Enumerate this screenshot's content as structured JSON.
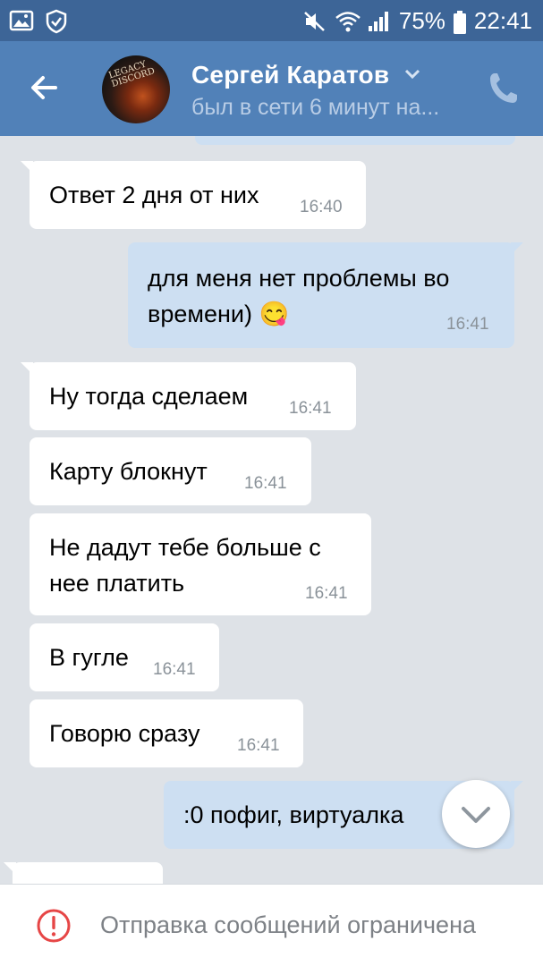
{
  "status_bar": {
    "battery": "75%",
    "time": "22:41",
    "icons": [
      "image-icon",
      "shield-icon",
      "mute-icon",
      "wifi-icon",
      "signal-icon",
      "battery-icon"
    ]
  },
  "header": {
    "contact_name": "Сергей Каратов",
    "contact_status": "был в сети 6 минут на...",
    "avatar_text": "LEGACY DISCORD",
    "colors": {
      "header_bg": "#5181b8",
      "status_bar_bg": "#3d6597"
    }
  },
  "messages": [
    {
      "direction": "in",
      "text": "Ответ 2 дня от них",
      "time": "16:40"
    },
    {
      "direction": "out",
      "text_line1": "для меня нет проблемы во",
      "text_line2": "времени) 😋",
      "time": "16:41"
    },
    {
      "direction": "in",
      "text": "Ну тогда сделаем",
      "time": "16:41"
    },
    {
      "direction": "in",
      "text": "Карту блокнут",
      "time": "16:41"
    },
    {
      "direction": "in",
      "text_line1": "Не дадут тебе больше с",
      "text_line2": "нее платить",
      "time": "16:41"
    },
    {
      "direction": "in",
      "text": "В гугле",
      "time": "16:41"
    },
    {
      "direction": "in",
      "text": "Говорю сразу",
      "time": "16:41"
    },
    {
      "direction": "out",
      "text": ":0 пофиг, виртуалка"
    }
  ],
  "bottom_bar": {
    "restriction_text": "Отправка сообщений ограничена"
  }
}
